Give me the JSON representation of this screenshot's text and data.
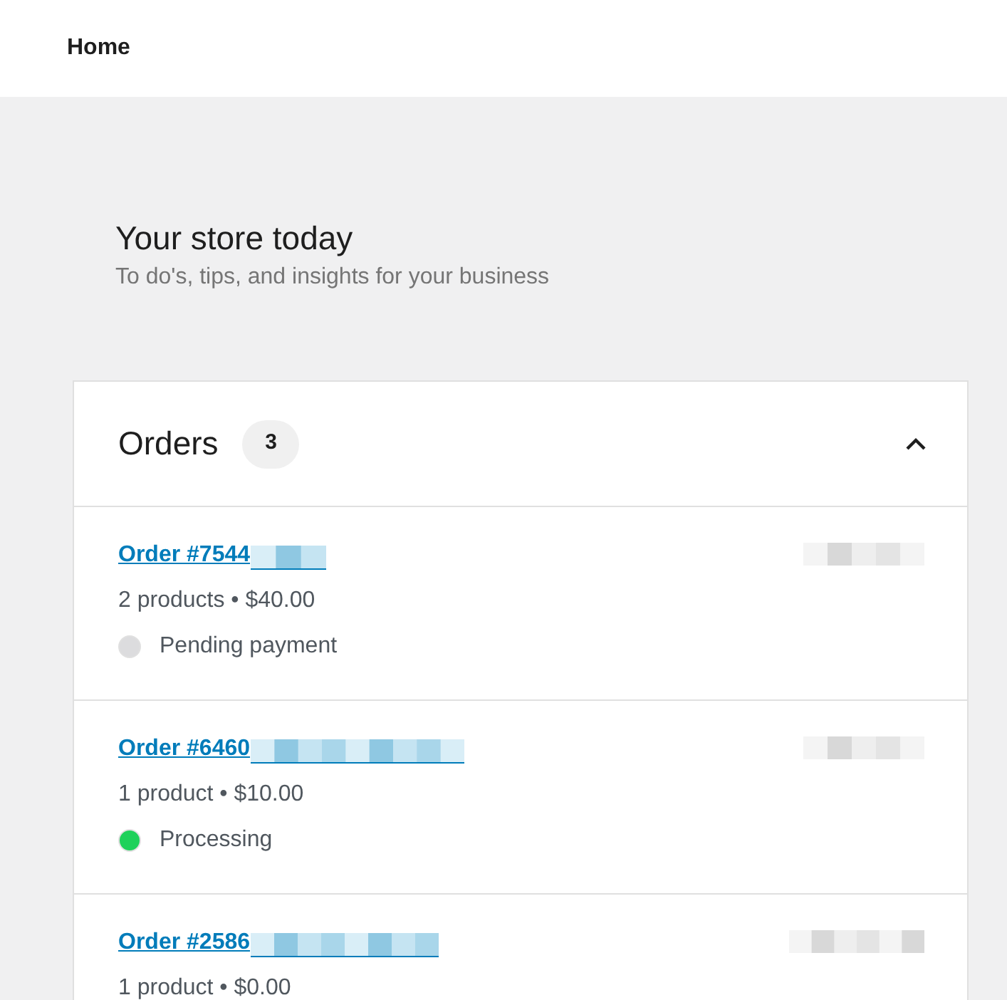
{
  "header": {
    "title": "Home"
  },
  "intro": {
    "title": "Your store today",
    "subtitle": "To do's, tips, and insights for your business"
  },
  "orders_card": {
    "title": "Orders",
    "count": "3",
    "expanded": true,
    "orders": [
      {
        "link": "Order #7544",
        "summary": "2 products • $40.00",
        "status": {
          "label": "Pending payment",
          "color": "#dcdcde"
        }
      },
      {
        "link": "Order #6460",
        "summary": "1 product • $10.00",
        "status": {
          "label": "Processing",
          "color": "#1ed15a"
        }
      },
      {
        "link": "Order #2586",
        "summary": "1 product • $0.00"
      }
    ]
  }
}
